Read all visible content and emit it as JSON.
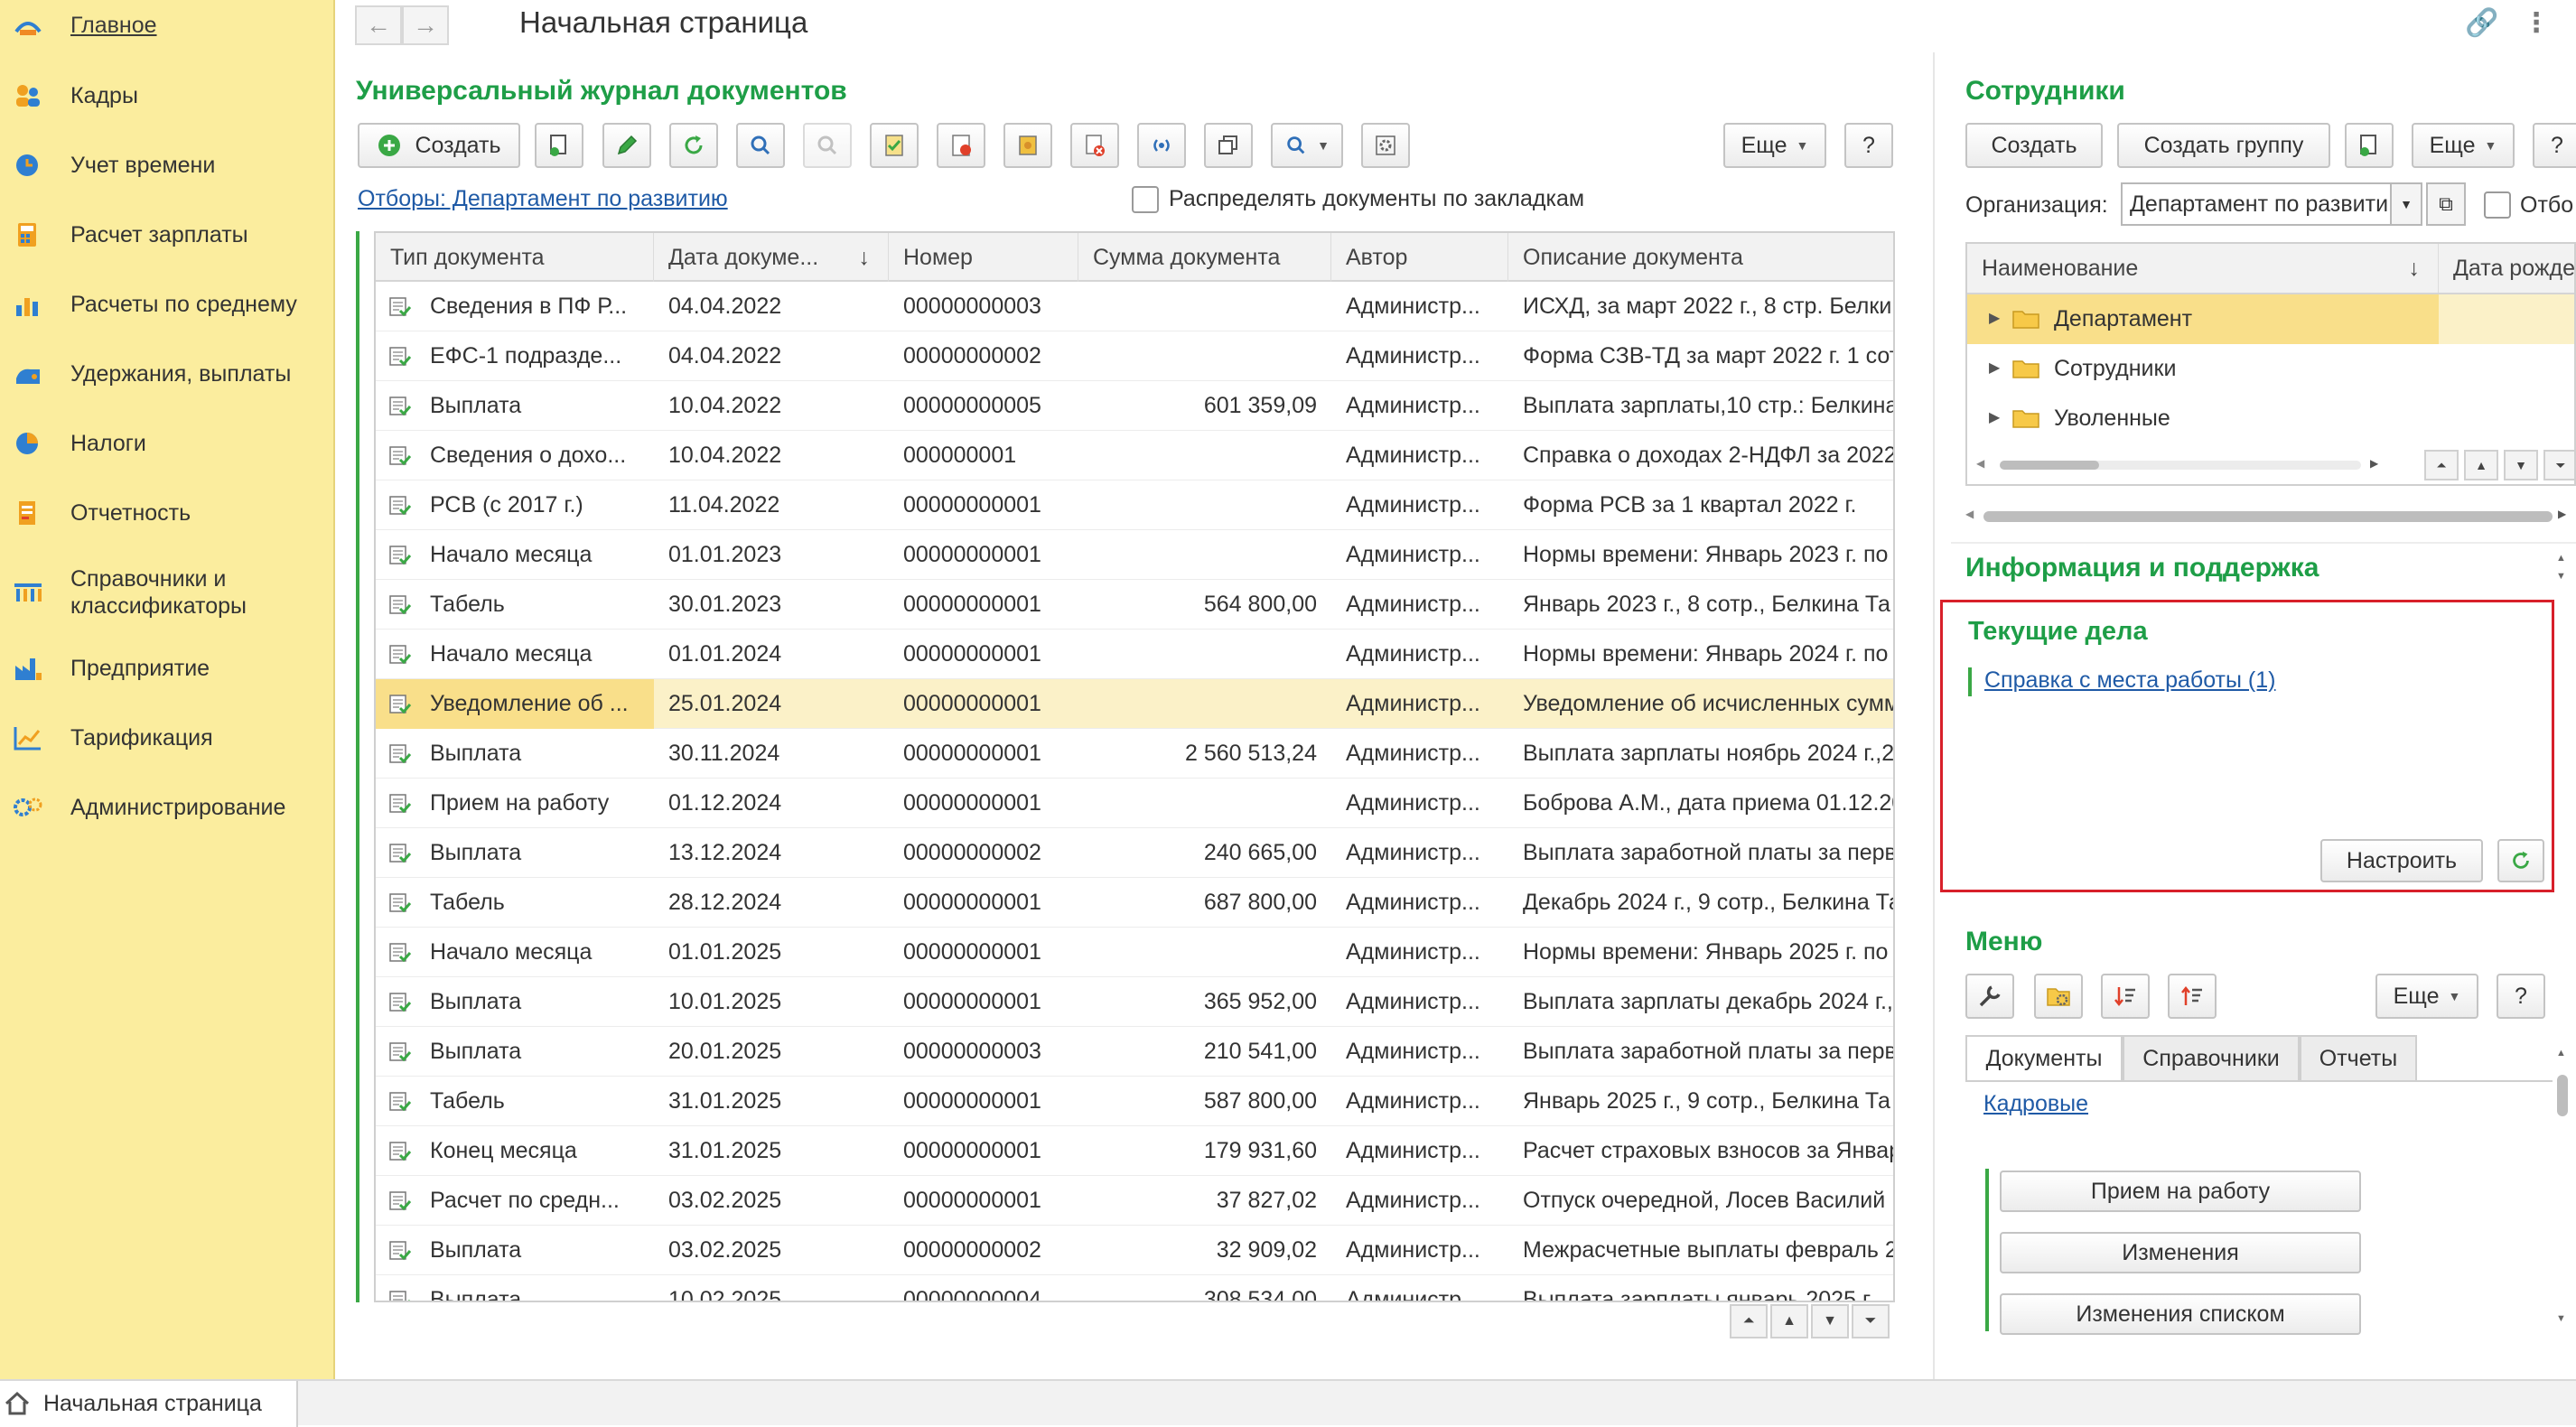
{
  "sidebar": {
    "items": [
      {
        "label": "Главное",
        "icon": "home-icon",
        "active": true
      },
      {
        "label": "Кадры",
        "icon": "people-icon"
      },
      {
        "label": "Учет времени",
        "icon": "clock-icon"
      },
      {
        "label": "Расчет зарплаты",
        "icon": "calculator-icon"
      },
      {
        "label": "Расчеты по среднему",
        "icon": "bar-chart-icon"
      },
      {
        "label": "Удержания, выплаты",
        "icon": "wallet-icon"
      },
      {
        "label": "Налоги",
        "icon": "pie-chart-icon"
      },
      {
        "label": "Отчетность",
        "icon": "report-icon"
      },
      {
        "label": "Справочники и\nклассификаторы",
        "icon": "catalog-icon"
      },
      {
        "label": "Предприятие",
        "icon": "factory-icon"
      },
      {
        "label": "Тарификация",
        "icon": "line-chart-icon"
      },
      {
        "label": "Администрирование",
        "icon": "gears-icon"
      }
    ]
  },
  "header": {
    "title": "Начальная страница",
    "back": "←",
    "forward": "→",
    "link_icon": "🔗",
    "more_icon": "⋮"
  },
  "journal": {
    "title": "Универсальный журнал документов",
    "create_label": "Создать",
    "more_label": "Еще",
    "help_label": "?",
    "filter_link": "Отборы: Департамент по развитию",
    "distribute_label": "Распределять документы по закладкам",
    "columns": [
      "Тип документа",
      "Дата докуме...",
      "Номер",
      "Сумма документа",
      "Автор",
      "Описание документа"
    ],
    "sort_indicator": "↓",
    "rows": [
      [
        "Сведения в ПФ Р...",
        "04.04.2022",
        "00000000003",
        "",
        "Администр...",
        "ИСХД, за март 2022 г., 8 стр. Белки"
      ],
      [
        "ЕФС-1 подразде...",
        "04.04.2022",
        "00000000002",
        "",
        "Администр...",
        "Форма СЗВ-ТД за март 2022 г. 1 сот"
      ],
      [
        "Выплата",
        "10.04.2022",
        "00000000005",
        "601 359,09",
        "Администр...",
        "Выплата зарплаты,10 стр.: Белкина"
      ],
      [
        "Сведения о дохо...",
        "10.04.2022",
        "000000001",
        "",
        "Администр...",
        "Справка о доходах 2-НДФЛ за 2022г"
      ],
      [
        "РСВ (с 2017 г.)",
        "11.04.2022",
        "00000000001",
        "",
        "Администр...",
        "Форма РСВ за 1 квартал 2022 г."
      ],
      [
        "Начало месяца",
        "01.01.2023",
        "00000000001",
        "",
        "Администр...",
        "Нормы времени: Январь 2023 г. по"
      ],
      [
        "Табель",
        "30.01.2023",
        "00000000001",
        "564 800,00",
        "Администр...",
        "Январь 2023 г., 8 сотр., Белкина Та"
      ],
      [
        "Начало месяца",
        "01.01.2024",
        "00000000001",
        "",
        "Администр...",
        "Нормы времени: Январь 2024 г. по"
      ],
      [
        "Уведомление об ...",
        "25.01.2024",
        "00000000001",
        "",
        "Администр...",
        "Уведомление об исчисленных сумм"
      ],
      [
        "Выплата",
        "30.11.2024",
        "00000000001",
        "2 560 513,24",
        "Администр...",
        "Выплата зарплаты ноябрь 2024 г.,2"
      ],
      [
        "Прием на работу",
        "01.12.2024",
        "00000000001",
        "",
        "Администр...",
        "Боброва А.М., дата приема 01.12.20"
      ],
      [
        "Выплата",
        "13.12.2024",
        "00000000002",
        "240 665,00",
        "Администр...",
        "Выплата заработной платы за перву"
      ],
      [
        "Табель",
        "28.12.2024",
        "00000000001",
        "687 800,00",
        "Администр...",
        "Декабрь 2024 г., 9 сотр., Белкина Та"
      ],
      [
        "Начало месяца",
        "01.01.2025",
        "00000000001",
        "",
        "Администр...",
        "Нормы времени: Январь 2025 г. по"
      ],
      [
        "Выплата",
        "10.01.2025",
        "00000000001",
        "365 952,00",
        "Администр...",
        "Выплата зарплаты декабрь 2024 г.,"
      ],
      [
        "Выплата",
        "20.01.2025",
        "00000000003",
        "210 541,00",
        "Администр...",
        "Выплата заработной платы за перву"
      ],
      [
        "Табель",
        "31.01.2025",
        "00000000001",
        "587 800,00",
        "Администр...",
        "Январь 2025 г., 9 сотр., Белкина Та"
      ],
      [
        "Конец месяца",
        "31.01.2025",
        "00000000001",
        "179 931,60",
        "Администр...",
        "Расчет страховых взносов за Январ"
      ],
      [
        "Расчет по средн...",
        "03.02.2025",
        "00000000001",
        "37 827,02",
        "Администр...",
        "Отпуск очередной, Лосев Василий I"
      ],
      [
        "Выплата",
        "03.02.2025",
        "00000000002",
        "32 909,02",
        "Администр...",
        "Межрасчетные выплаты февраль 2"
      ],
      [
        "Выплата",
        "10.02.2025",
        "00000000004",
        "308 534,00",
        "Администр...",
        "Выплата зарплаты январь 2025 г.,"
      ]
    ],
    "selected_row": 8
  },
  "employees": {
    "title": "Сотрудники",
    "create_label": "Создать",
    "create_group_label": "Создать группу",
    "more_label": "Еще",
    "help_label": "?",
    "org_label": "Организация:",
    "org_value": "Департамент по развити",
    "filter_label": "Отбо",
    "columns": [
      "Наименование",
      "Дата рожде"
    ],
    "sort_indicator": "↓",
    "tree": [
      "Департамент",
      "Сотрудники",
      "Уволенные"
    ]
  },
  "info": {
    "title": "Информация и поддержка"
  },
  "tasks": {
    "title": "Текущие дела",
    "link": "Справка с места работы (1)",
    "configure_label": "Настроить"
  },
  "menu": {
    "title": "Меню",
    "more_label": "Еще",
    "help_label": "?",
    "tabs": [
      "Документы",
      "Справочники",
      "Отчеты"
    ],
    "group_link": "Кадровые",
    "commands": [
      "Прием на работу",
      "Изменения",
      "Изменения списком"
    ]
  },
  "bottom": {
    "tab_label": "Начальная страница"
  },
  "colors": {
    "sidebar_bg": "#fbed9e",
    "accent_green": "#1e9e47",
    "link_blue": "#1f5aa6",
    "highlight_red": "#d8202a",
    "selected_row": "#fbf1c8"
  }
}
